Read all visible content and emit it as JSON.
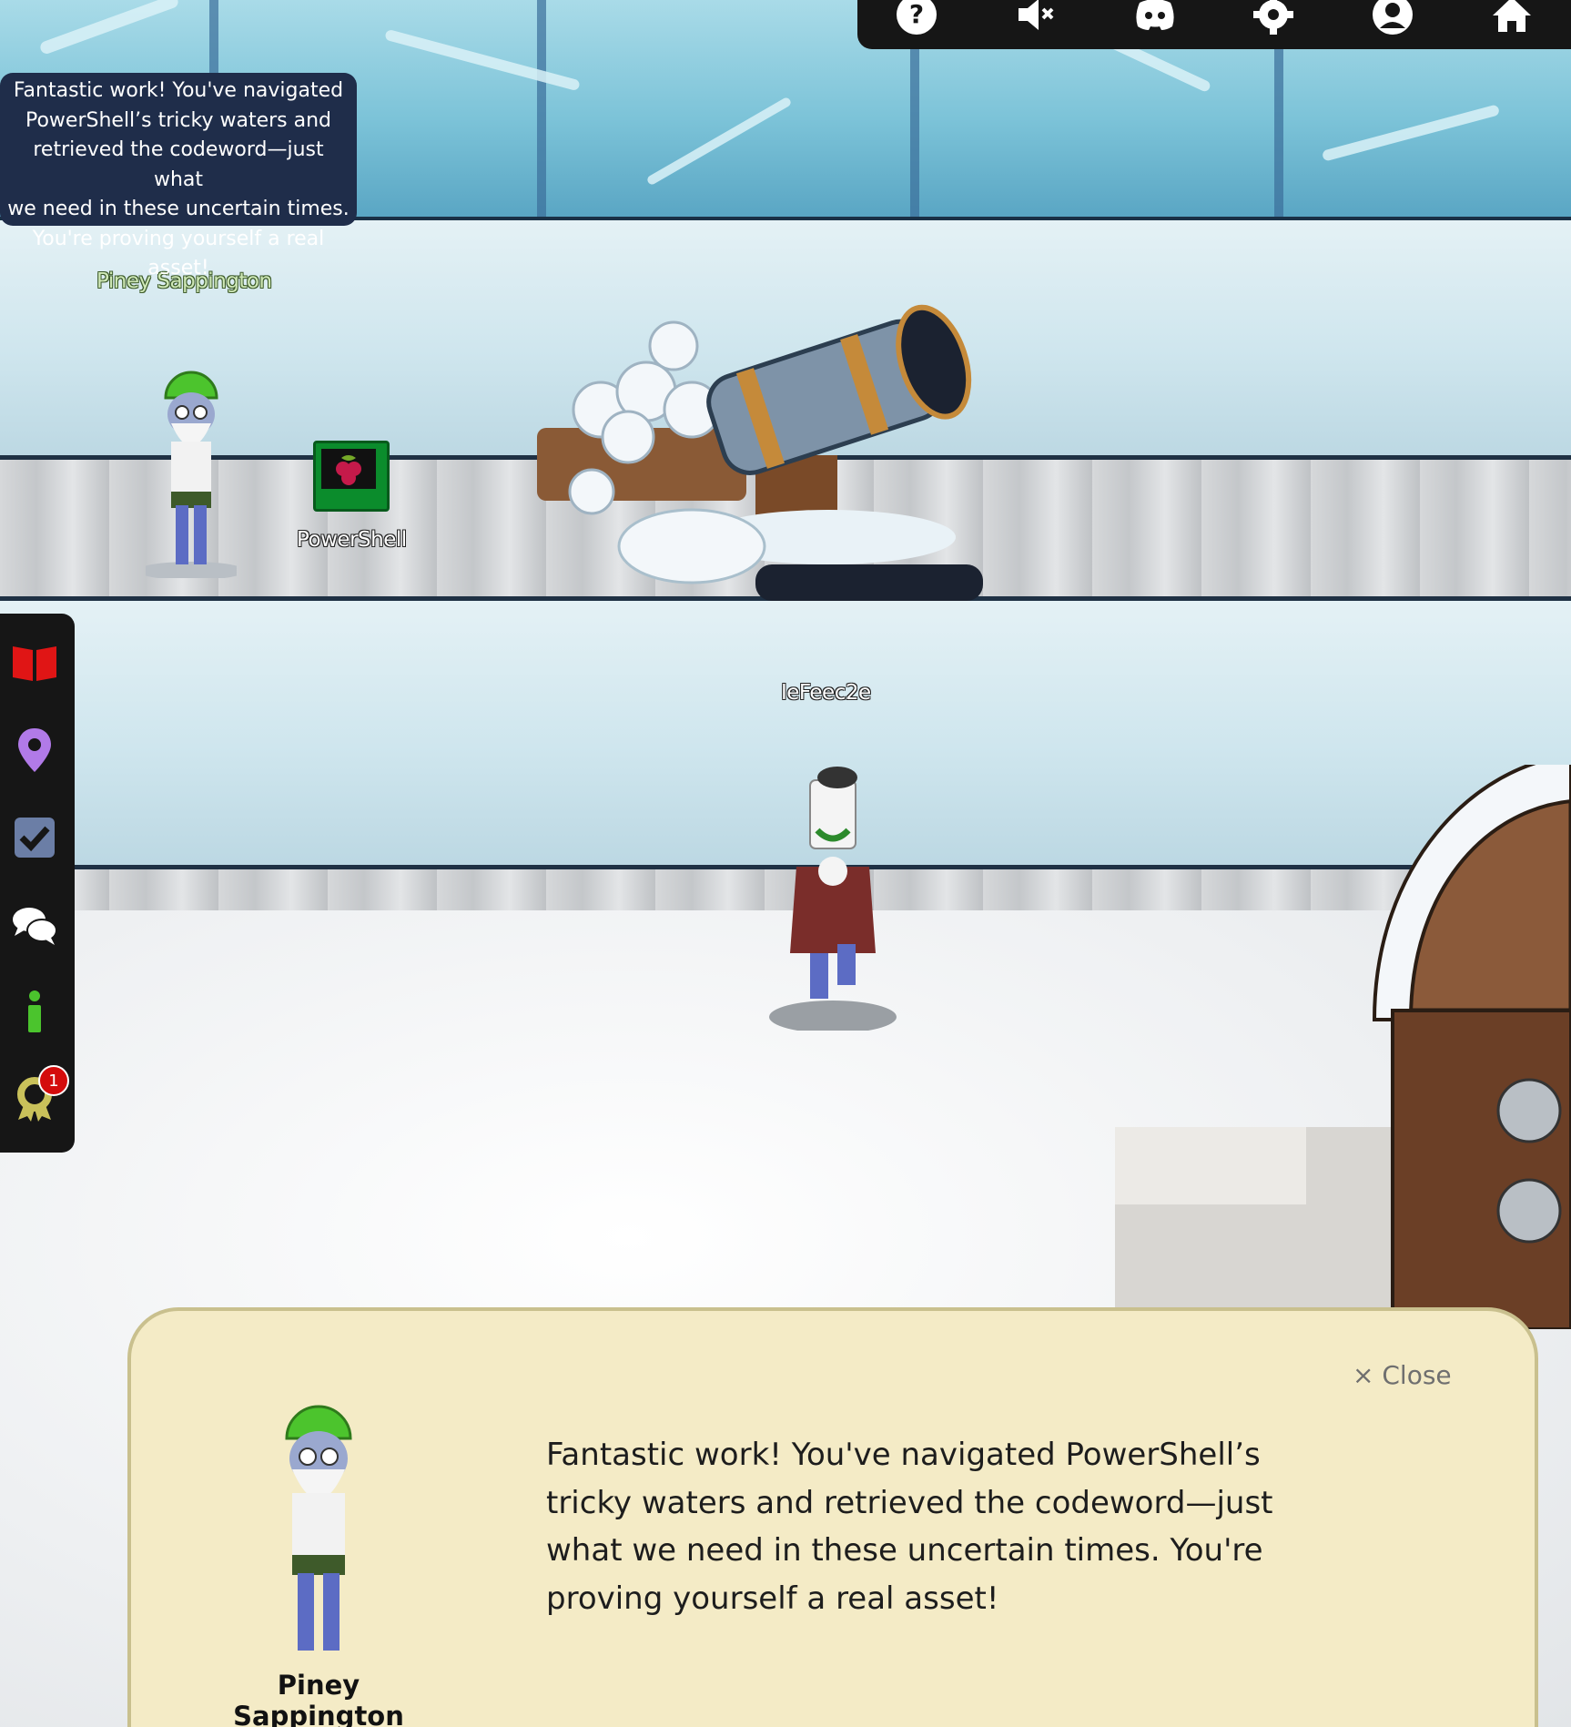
{
  "toolbar": {
    "icons": [
      "help-icon",
      "mute-icon",
      "discord-icon",
      "settings-icon",
      "account-icon",
      "home-icon"
    ]
  },
  "sidebar": {
    "icons": [
      "book-icon",
      "map-pin-icon",
      "checkbox-icon",
      "chat-icon",
      "info-icon",
      "achievement-icon"
    ],
    "achievement_badge": "1"
  },
  "speech_bubble": {
    "lines": [
      "Fantastic work! You've navigated",
      "PowerShell’s tricky waters and",
      "retrieved the codeword—just what",
      "we need in these uncertain times.",
      "You're proving yourself a real asset!"
    ]
  },
  "characters": {
    "npc_name": "Piney Sappington",
    "terminal_name": "PowerShell",
    "player_name": "IeFeec2e"
  },
  "dialog": {
    "close_label": "× Close",
    "text": "Fantastic work! You've navigated PowerShell’s tricky waters and retrieved the codeword—just what we need in these uncertain times. You're proving yourself a real asset!",
    "speaker": "Piney Sappington"
  },
  "colors": {
    "toolbar_bg": "#161616",
    "dialog_bg": "#f4ebc6",
    "bubble_bg": "#1f2d4a",
    "badge": "#d40c0c"
  }
}
